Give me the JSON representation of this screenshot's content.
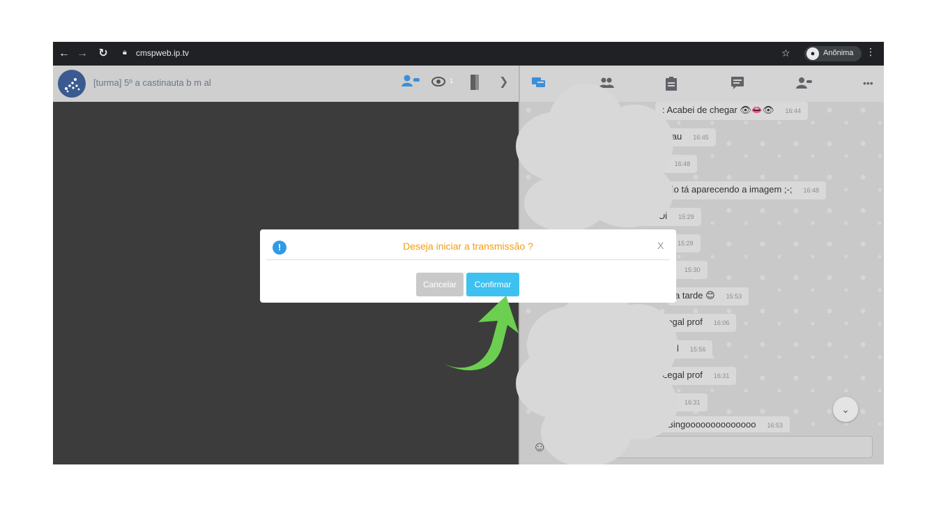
{
  "browser": {
    "url": "cmspweb.ip.tv",
    "profile_label": "Anônima",
    "icons": {
      "back": "back-arrow-icon",
      "forward": "forward-arrow-icon",
      "reload": "reload-icon",
      "lock": "lock-icon",
      "star": "star-icon",
      "incognito": "incognito-icon",
      "menu": "kebab-menu-icon"
    }
  },
  "room": {
    "title": "[turma] 5º a castinauta b m al",
    "viewer_count": "1"
  },
  "chat": {
    "messages": [
      {
        "text": ": Acabei de chegar 👁👄👁",
        "time": "16:44"
      },
      {
        "text": "chau",
        "time": "16:45"
      },
      {
        "text": ";-;",
        "time": "16:48"
      },
      {
        "text": "Não tá aparecendo a imagem ;-;",
        "time": "16:48"
      },
      {
        "text": "p : Oi",
        "time": "15:29"
      },
      {
        "text": "",
        "time": "15:29"
      },
      {
        "text": "",
        "time": "15:30"
      },
      {
        "text": "a tarde 😊",
        "time": "15:53"
      },
      {
        "text": "Legal prof",
        "time": "16:06"
      },
      {
        "text": "chal",
        "time": "15:56"
      },
      {
        "text": "Legal prof",
        "time": "16:31"
      },
      {
        "text": "",
        "time": "16:31"
      },
      {
        "text": ": Bingoooooooooooooo",
        "time": "16:53"
      }
    ]
  },
  "modal": {
    "title": "Deseja iniciar a transmissão ?",
    "close_label": "X",
    "icon_label": "!",
    "cancel_label": "Cancelar",
    "confirm_label": "Confirmar"
  },
  "colors": {
    "modal_title": "#f39c12",
    "confirm": "#3ec1f0",
    "cancel": "#c9c9c9",
    "accent_icons": "#3a8fd8",
    "annotation_arrow": "#6ccf4f"
  }
}
